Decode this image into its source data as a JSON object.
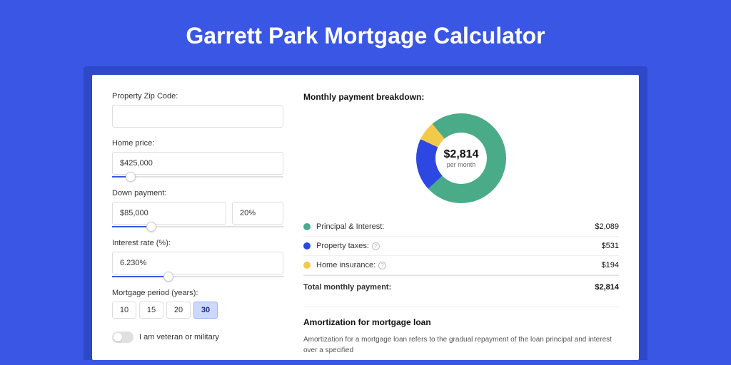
{
  "title": "Garrett Park Mortgage Calculator",
  "form": {
    "zip_label": "Property Zip Code:",
    "zip_value": "",
    "home_price_label": "Home price:",
    "home_price_value": "$425,000",
    "down_payment_label": "Down payment:",
    "down_payment_value": "$85,000",
    "down_payment_pct": "20%",
    "interest_label": "Interest rate (%):",
    "interest_value": "6.230%",
    "period_label": "Mortgage period (years):",
    "periods": [
      "10",
      "15",
      "20",
      "30"
    ],
    "period_selected": "30",
    "veteran_label": "I am veteran or military"
  },
  "breakdown": {
    "title": "Monthly payment breakdown:",
    "donut_amount": "$2,814",
    "donut_sub": "per month",
    "items": [
      {
        "label": "Principal & Interest:",
        "value": "$2,089",
        "color": "#4aab88",
        "info": false
      },
      {
        "label": "Property taxes:",
        "value": "$531",
        "color": "#2d48e2",
        "info": true
      },
      {
        "label": "Home insurance:",
        "value": "$194",
        "color": "#f3c94b",
        "info": true
      }
    ],
    "total_label": "Total monthly payment:",
    "total_value": "$2,814"
  },
  "amort": {
    "title": "Amortization for mortgage loan",
    "text": "Amortization for a mortgage loan refers to the gradual repayment of the loan principal and interest over a specified"
  },
  "colors": {
    "principal": "#4aab88",
    "taxes": "#2d48e2",
    "insurance": "#f3c94b"
  },
  "chart_data": {
    "type": "pie",
    "title": "Monthly payment breakdown",
    "series": [
      {
        "name": "Principal & Interest",
        "value": 2089,
        "color": "#4aab88"
      },
      {
        "name": "Property taxes",
        "value": 531,
        "color": "#2d48e2"
      },
      {
        "name": "Home insurance",
        "value": 194,
        "color": "#f3c94b"
      }
    ],
    "total": 2814,
    "unit": "USD per month"
  }
}
